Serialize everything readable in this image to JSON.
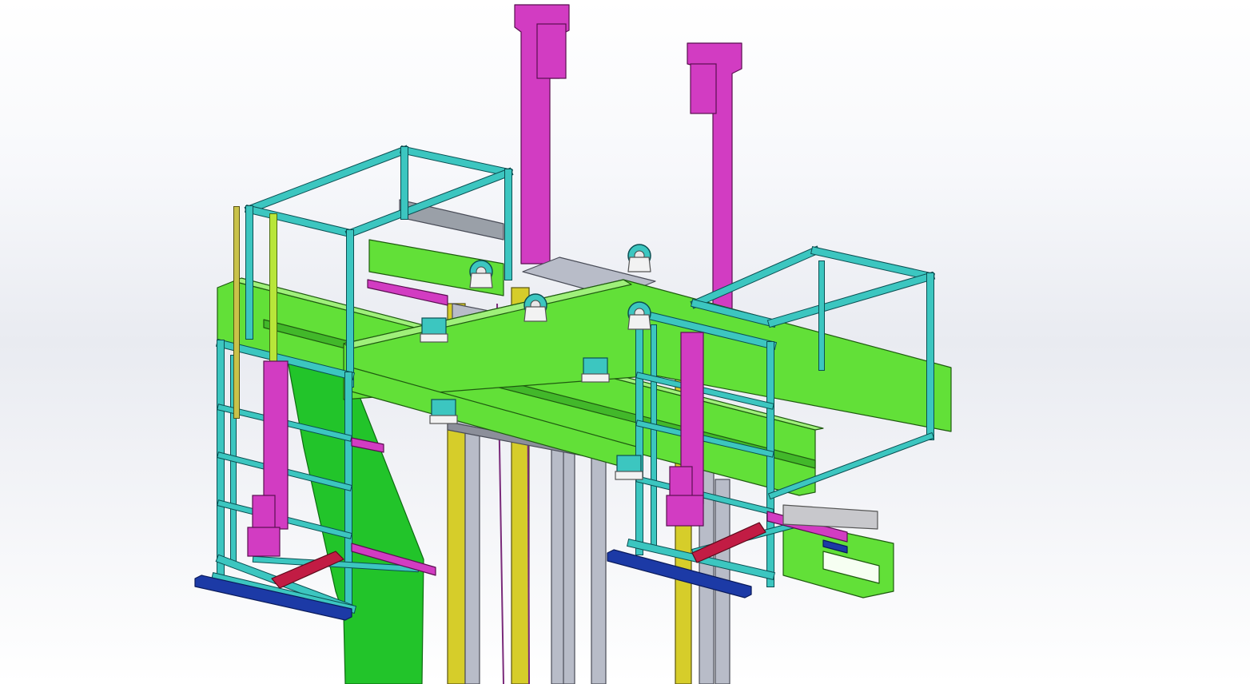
{
  "viewport": {
    "background_top": "#ffffff",
    "background_mid": "#e8eaf0",
    "background_bottom": "#ffffff"
  },
  "model": {
    "name": "",
    "colors": {
      "frame": "#3cc6c0",
      "frame_edge": "#0b4f52",
      "beam": "#62e038",
      "beam_edge": "#1f5a10",
      "column": "#d23cc2",
      "column_edge": "#5a0f50",
      "mast": "#d6cd2a",
      "mast_edge": "#5a5410",
      "grey": "#b8bcc8",
      "grey_edge": "#4a4d58",
      "cylinder": "#c21c44",
      "blue_bar": "#1c3aa6",
      "light_green": "#b8e63a",
      "belt": "#22c42a",
      "cable": "#7a2a7a"
    },
    "components": [
      "column-left",
      "column-right",
      "frame-left",
      "frame-right",
      "crossbeam",
      "mast",
      "pulley-block",
      "belt-strip",
      "cylinder",
      "base-bar",
      "motor",
      "pulley"
    ]
  }
}
